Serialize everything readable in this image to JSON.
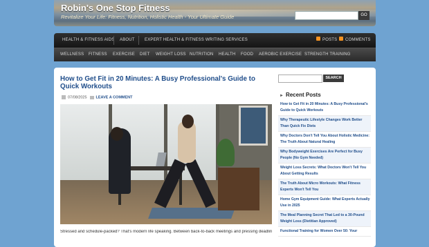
{
  "header": {
    "title": "Robin's One Stop Fitness",
    "tagline": "Revitalize Your Life: Fitness, Nutrition, Holistic Health - Your Ultimate Guide",
    "search_placeholder": "",
    "go_label": "GO"
  },
  "nav_primary": {
    "items": [
      "HEALTH & FITNESS AIDS",
      "ABOUT",
      "EXPERT HEALTH & FITNESS WRITING SERVICES"
    ],
    "posts_label": "POSTS",
    "comments_label": "COMMENTS"
  },
  "nav_categories": [
    "WELLNESS",
    "FITNESS",
    "EXERCISE",
    "DIET",
    "WEIGHT LOSS",
    "NUTRITION",
    "HEALTH",
    "FOOD",
    "AEROBIC EXERCISE",
    "STRENGTH TRAINING"
  ],
  "post": {
    "title": "How to Get Fit in 20 Minutes: A Busy Professional's Guide to Quick Workouts",
    "date": "07/08/2025",
    "comment_link": "LEAVE A COMMENT",
    "excerpt": "Stressed and schedule-packed? That's modern life speaking. Between back-to-back meetings and pressing deadlines,"
  },
  "sidebar": {
    "search_button": "SEARCH",
    "recent_heading": "Recent Posts",
    "recent_posts": [
      "How to Get Fit in 20 Minutes: A Busy Professional's Guide to Quick Workouts",
      "Why Therapeutic Lifestyle Changes Work Better Than Quick Fix Diets",
      "Why Doctors Don't Tell You About Holistic Medicine: The Truth About Natural Healing",
      "Why Bodyweight Exercises Are Perfect for Busy People (No Gym Needed)",
      "Weight Loss Secrets: What Doctors Won't Tell You About Getting Results",
      "The Truth About Micro Workouts: What Fitness Experts Won't Tell You",
      "Home Gym Equipment Guide: What Experts Actually Use in 2025",
      "The Meal Planning Secret That Led to a 30-Pound Weight Loss (Dietitian Approved)",
      "Functional Training for Women Over 50: Your"
    ]
  },
  "colors": {
    "page_background": "#6fa3d1",
    "link_blue": "#1f4d8a",
    "nav_dark": "#1e1e1e"
  }
}
